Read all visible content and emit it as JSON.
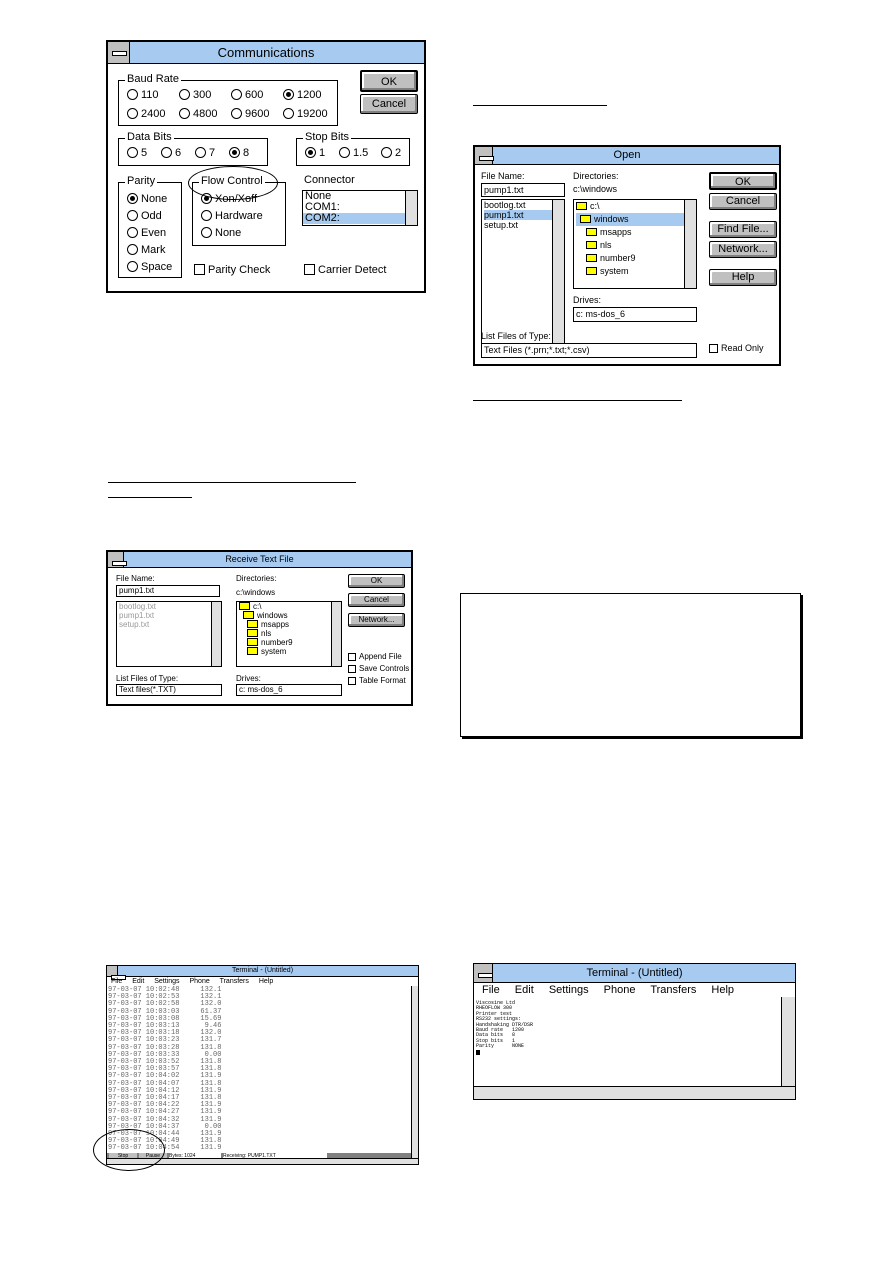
{
  "comm": {
    "title": "Communications",
    "ok": "OK",
    "cancel": "Cancel",
    "baud": {
      "label": "Baud Rate",
      "options": [
        "110",
        "300",
        "600",
        "1200",
        "2400",
        "4800",
        "9600",
        "19200"
      ],
      "selected": "1200"
    },
    "data_bits": {
      "label": "Data Bits",
      "options": [
        "5",
        "6",
        "7",
        "8"
      ],
      "selected": "8"
    },
    "stop_bits": {
      "label": "Stop Bits",
      "options": [
        "1",
        "1.5",
        "2"
      ],
      "selected": "1"
    },
    "parity": {
      "label": "Parity",
      "options": [
        "None",
        "Odd",
        "Even",
        "Mark",
        "Space"
      ],
      "selected": "None"
    },
    "flow": {
      "label": "Flow Control",
      "options": [
        "Xon/Xoff",
        "Hardware",
        "None"
      ],
      "selected": "Xon/Xoff"
    },
    "connector": {
      "label": "Connector",
      "options": [
        "None",
        "COM1:",
        "COM2:"
      ],
      "selected": "COM2:"
    },
    "parity_check": "Parity Check",
    "carrier_detect": "Carrier Detect"
  },
  "recv": {
    "title": "Receive Text File",
    "file_name_label": "File Name:",
    "file_name": "pump1.txt",
    "files": [
      "bootlog.txt",
      "pump1.txt",
      "setup.txt"
    ],
    "dirs_label": "Directories:",
    "dir_path": "c:\\windows",
    "dirs": [
      "c:\\",
      "windows",
      "msapps",
      "nls",
      "number9",
      "system"
    ],
    "ok": "OK",
    "cancel": "Cancel",
    "network": "Network...",
    "append": "Append File",
    "save_controls": "Save Controls",
    "table_format": "Table Format",
    "type_label": "List Files of Type:",
    "type": "Text files(*.TXT)",
    "drives_label": "Drives:",
    "drive": "c: ms-dos_6"
  },
  "open": {
    "title": "Open",
    "file_name_label": "File Name:",
    "file_name": "pump1.txt",
    "files": [
      "bootlog.txt",
      "pump1.txt",
      "setup.txt"
    ],
    "dirs_label": "Directories:",
    "dir_path": "c:\\windows",
    "dirs": [
      "c:\\",
      "windows",
      "msapps",
      "nls",
      "number9",
      "system"
    ],
    "ok": "OK",
    "cancel": "Cancel",
    "find": "Find File...",
    "network": "Network...",
    "help": "Help",
    "drives_label": "Drives:",
    "drive": "c: ms-dos_6",
    "type_label": "List Files of Type:",
    "type": "Text Files (*.prn;*.txt;*.csv)",
    "read_only": "Read Only"
  },
  "term1": {
    "title": "Terminal - (Untitled)",
    "menu": [
      "File",
      "Edit",
      "Settings",
      "Phone",
      "Transfers",
      "Help"
    ],
    "rows": [
      "97-03-07 10:02:48     132.1",
      "97-03-07 10:02:53     132.1",
      "97-03-07 10:02:58     132.0",
      "97-03-07 10:03:03     61.37",
      "97-03-07 10:03:08     15.69",
      "97-03-07 10:03:13      9.46",
      "97-03-07 10:03:18     132.0",
      "97-03-07 10:03:23     131.7",
      "97-03-07 10:03:28     131.8",
      "97-03-07 10:03:33      0.00",
      "97-03-07 10:03:52     131.8",
      "97-03-07 10:03:57     131.8",
      "97-03-07 10:04:02     131.9",
      "97-03-07 10:04:07     131.8",
      "97-03-07 10:04:12     131.9",
      "97-03-07 10:04:17     131.8",
      "97-03-07 10:04:22     131.9",
      "97-03-07 10:04:27     131.9",
      "97-03-07 10:04:32     131.9",
      "97-03-07 10:04:37      0.00",
      "97-03-07 10:04:44     131.9",
      "97-03-07 10:04:49     131.8",
      "97-03-07 10:04:54     131.9"
    ],
    "stop": "Stop",
    "pause": "Pause",
    "bytes": "Bytes: 1024",
    "receiving": "Receiving: PUMP1.TXT"
  },
  "term2": {
    "title": "Terminal - (Untitled)",
    "menu": [
      "File",
      "Edit",
      "Settings",
      "Phone",
      "Transfers",
      "Help"
    ],
    "rows": [
      "Viscosine Ltd",
      "RHEOFLOW 300",
      "Printer test",
      "RS232 settings:",
      "Handshaking DTR/DSR",
      "Baud rate   1200",
      "Data bits   8",
      "Stop bits   1",
      "Parity      NONE"
    ]
  }
}
